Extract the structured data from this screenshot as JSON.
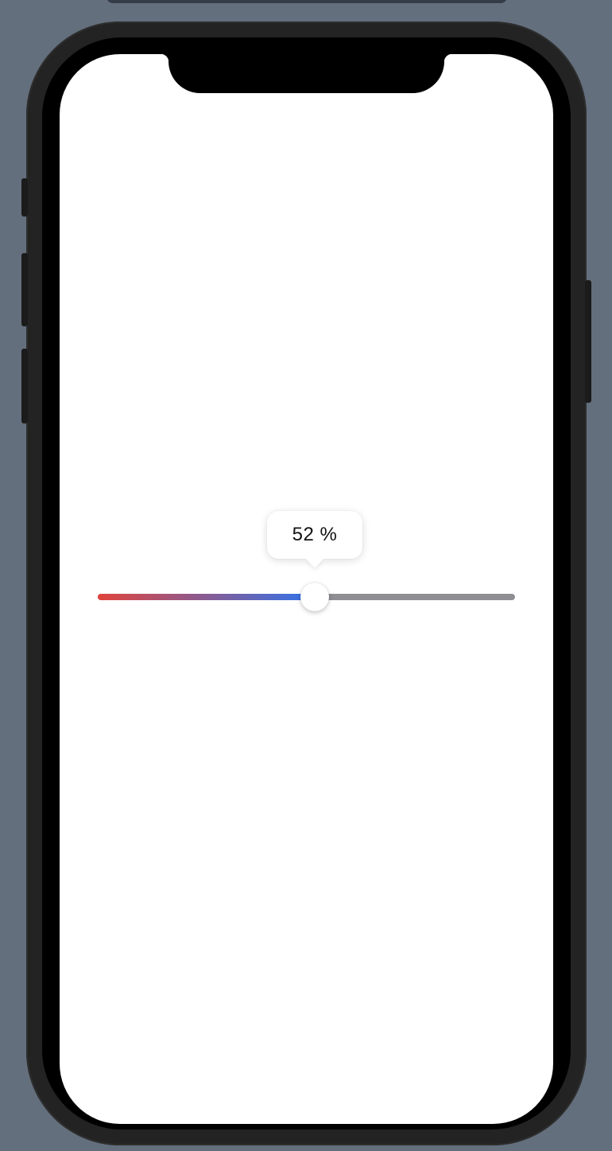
{
  "slider": {
    "value": 52,
    "value_label": "52 %",
    "min_color": "#e0443c",
    "max_color": "#2f74ec",
    "track_color": "#8e8e93"
  }
}
